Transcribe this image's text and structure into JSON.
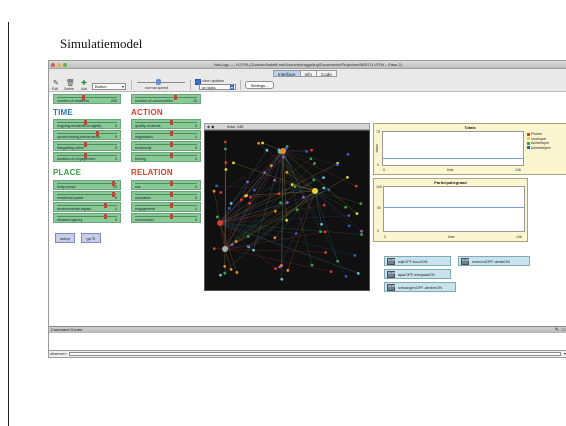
{
  "slide": {
    "title": "Simulatiemodel"
  },
  "window": {
    "title": "NetLogo — YUTPA (/Domain/tudelft.net/Users/mbruggeling/Documents/Projecten/BART/YUTPA – Fase 2)"
  },
  "tabs": [
    {
      "label": "Interface"
    },
    {
      "label": "Info"
    },
    {
      "label": "Code"
    }
  ],
  "toolbar": {
    "edit_label": "Edit",
    "delete_label": "Delete",
    "add_label": "Add",
    "widget_type": "Button",
    "speed_label": "normal speed",
    "view_updates_label": "view updates",
    "update_mode": "on ticks",
    "settings_label": "Settings..."
  },
  "top_sliders": [
    {
      "label": "number-of-residents",
      "value": "200"
    },
    {
      "label": "number-of-communities",
      "value": "15"
    }
  ],
  "sections": {
    "time": "TIME",
    "action": "ACTION",
    "place": "PLACE",
    "relation": "RELATION"
  },
  "time_sliders": [
    {
      "label": "ongoing-residents-to-signify",
      "value": "3"
    },
    {
      "label": "synchronizing-performance",
      "value": "5"
    },
    {
      "label": "integrating-rythm",
      "value": "3"
    },
    {
      "label": "duration-of-engagement",
      "value": "3"
    }
  ],
  "action_sliders": [
    {
      "label": "quality-of-deeds",
      "value": "4"
    },
    {
      "label": "negotiation",
      "value": "4"
    },
    {
      "label": "reciprocity",
      "value": "4"
    },
    {
      "label": "belong",
      "value": "4"
    }
  ],
  "place_sliders": [
    {
      "label": "body-sense",
      "value": "13"
    },
    {
      "label": "emotional-space",
      "value": "6"
    },
    {
      "label": "environmental-impact",
      "value": "4"
    },
    {
      "label": "situated-agency",
      "value": "4"
    }
  ],
  "relation_sliders": [
    {
      "label": "risk",
      "value": "4"
    },
    {
      "label": "reputation",
      "value": "4"
    },
    {
      "label": "engagement",
      "value": "4"
    },
    {
      "label": "communion",
      "value": "4"
    }
  ],
  "buttons": {
    "setup": "setup",
    "go": "go"
  },
  "world": {
    "ticks_label": "ticks: 145"
  },
  "plots": {
    "totals": {
      "title": "Totals",
      "ylabel": "totals",
      "xlabel": "time",
      "xmin": "0",
      "xmax": "146",
      "ymax": "75",
      "ymin": "0",
      "legend": [
        {
          "name": "Pionier",
          "color": "#d83a2e"
        },
        {
          "name": "Voorloper",
          "color": "#e8d53a"
        },
        {
          "name": "Achterloper",
          "color": "#3da44b"
        },
        {
          "name": "Achterblijver",
          "color": "#2f5db8"
        }
      ]
    },
    "participation": {
      "title": "Participatiegraad",
      "xlabel": "time",
      "xmin": "0",
      "xmax": "146",
      "ymax": "100",
      "ymid": "50",
      "ymin": "0"
    }
  },
  "switches": [
    {
      "label": "wijkOFF-buurtON",
      "icon": "On Off"
    },
    {
      "label": "evenredOFF-derdeON",
      "icon": "On Off"
    },
    {
      "label": "aparOFF-integraalON",
      "icon": "On Off"
    },
    {
      "label": "ontvangenOFF-derdenON",
      "icon": "On Off"
    }
  ],
  "command_center": {
    "title": "Command Center",
    "observer_label": "observer>"
  },
  "icons": [
    "close-icon",
    "minimize-icon",
    "zoom-icon",
    "edit-icon",
    "delete-icon",
    "add-icon",
    "chevron-down-icon"
  ]
}
